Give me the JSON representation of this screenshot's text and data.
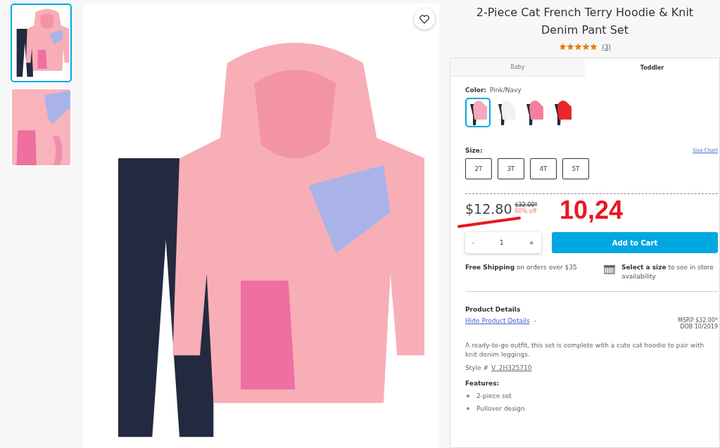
{
  "gallery": {
    "thumbnails": [
      {
        "selected": true,
        "kind": "outfit"
      },
      {
        "selected": false,
        "kind": "detail"
      }
    ]
  },
  "product": {
    "title": "2-Piece Cat French Terry Hoodie & Knit Denim Pant Set",
    "stars": 5,
    "review_count": "(3)"
  },
  "tabs": [
    {
      "label": "Baby",
      "selected": false
    },
    {
      "label": "Toddler",
      "selected": true
    }
  ],
  "color": {
    "label": "Color:",
    "value": "Pink/Navy",
    "swatches": [
      {
        "selected": true,
        "color": "#f6a9b8"
      },
      {
        "selected": false,
        "color": "#f1f1f1"
      },
      {
        "selected": false,
        "color": "#f47f9c"
      },
      {
        "selected": false,
        "color": "#e8262c"
      }
    ]
  },
  "size": {
    "label": "Size:",
    "size_chart_link": "Size Chart",
    "options": [
      {
        "label": "2T",
        "selected": false
      },
      {
        "label": "3T",
        "selected": false
      },
      {
        "label": "4T",
        "selected": false
      },
      {
        "label": "5T",
        "selected": false
      }
    ]
  },
  "price": {
    "sale_price": "$12.80",
    "original_price": "$32.00*",
    "discount": "60% off"
  },
  "annotation": {
    "text": "10,24"
  },
  "quantity": {
    "minus": "-",
    "value": "1",
    "plus": "+"
  },
  "add_to_cart": "Add to Cart",
  "shipping": {
    "text": "**Free Shipping** on orders over $35"
  },
  "store": {
    "text": "**Select a size** to see in store availability"
  },
  "details": {
    "heading": "Product Details",
    "toggle_link": "Hide Product Details",
    "toggle_mark": "-",
    "msrp": "MSRP $32.00*",
    "dob": "DOB 10/2019",
    "description": "A ready-to-go outfit, this set is complete with a cute cat hoodie to pair with knit denim leggings.",
    "style_label": "Style #",
    "style_number": "V_2H325710",
    "features_heading": "Features:",
    "features": [
      "2-piece set",
      "Pullover design"
    ]
  }
}
